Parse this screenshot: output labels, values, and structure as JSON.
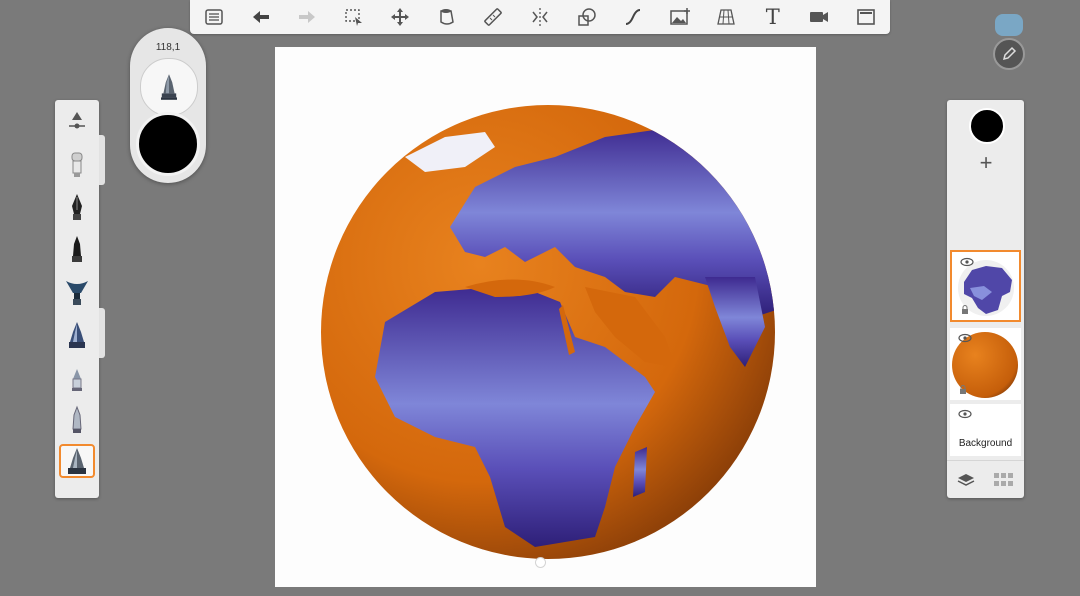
{
  "toolbar": {
    "items": [
      {
        "name": "layers-list-icon",
        "label": "Layers list"
      },
      {
        "name": "undo-icon",
        "label": "Undo"
      },
      {
        "name": "redo-icon",
        "label": "Redo"
      },
      {
        "name": "selection-icon",
        "label": "Selection"
      },
      {
        "name": "move-icon",
        "label": "Transform"
      },
      {
        "name": "fill-icon",
        "label": "Fill"
      },
      {
        "name": "ruler-icon",
        "label": "Ruler"
      },
      {
        "name": "symmetry-icon",
        "label": "Symmetry"
      },
      {
        "name": "shapes-icon",
        "label": "Shapes"
      },
      {
        "name": "curve-icon",
        "label": "Curve"
      },
      {
        "name": "image-icon",
        "label": "Image"
      },
      {
        "name": "perspective-icon",
        "label": "Perspective grid"
      },
      {
        "name": "text-icon",
        "label": "T"
      },
      {
        "name": "video-icon",
        "label": "Record"
      },
      {
        "name": "fullscreen-icon",
        "label": "Fullscreen"
      }
    ]
  },
  "brush_preview": {
    "size_value": "118,1",
    "color": "#000000"
  },
  "brush_library": {
    "items": [
      {
        "name": "brush-settings-icon"
      },
      {
        "name": "airbrush-icon"
      },
      {
        "name": "pen-nib-icon"
      },
      {
        "name": "marker-icon"
      },
      {
        "name": "paint-brush-icon"
      },
      {
        "name": "ink-brush-icon"
      },
      {
        "name": "pencil-icon"
      },
      {
        "name": "hard-pencil-icon"
      },
      {
        "name": "selected-brush-icon"
      }
    ],
    "selected_index": 8
  },
  "layers": {
    "current_color": "#000000",
    "add_label": "+",
    "items": [
      {
        "name": "layer-earth-purple",
        "selected": true
      },
      {
        "name": "layer-earth-orange",
        "selected": false
      },
      {
        "name": "layer-background",
        "label": "Background"
      }
    ]
  },
  "colors": {
    "accent": "#f28a2e",
    "orange": "#d9700f",
    "purple": "#4b2f9a"
  }
}
